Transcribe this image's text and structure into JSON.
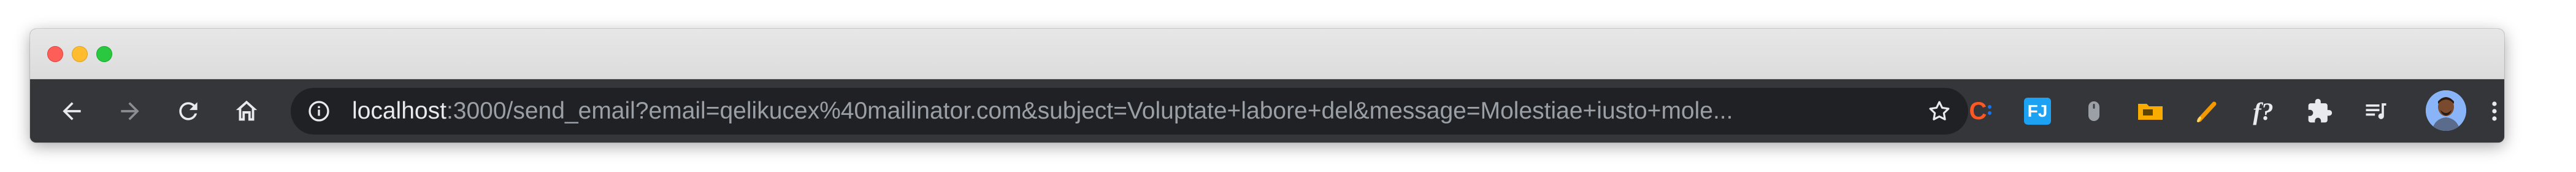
{
  "window": {
    "traffic_lights": {
      "close": "#fd5e57",
      "minimize": "#febc2e",
      "maximize": "#29c840"
    }
  },
  "toolbar": {
    "back_icon": "arrow-left-icon",
    "forward_icon": "arrow-right-icon",
    "reload_icon": "reload-icon",
    "home_icon": "home-icon"
  },
  "omnibox": {
    "info_icon": "info-icon",
    "url_host": "localhost",
    "url_rest": ":3000/send_email?email=qelikucex%40mailinator.com&subject=Voluptate+labore+del&message=Molestiae+iusto+mole...",
    "bookmark_icon": "star-icon"
  },
  "extensions": [
    {
      "name": "c-extension-icon",
      "label": "C",
      "color": "#ff5722"
    },
    {
      "name": "fj-extension-icon",
      "label": "FJ",
      "color": "#1da1f2"
    },
    {
      "name": "mouse-extension-icon"
    },
    {
      "name": "folder-extension-icon",
      "color": "#f9ab00"
    },
    {
      "name": "pen-extension-icon",
      "color": "#f29900"
    },
    {
      "name": "fonts-extension-icon",
      "label": "f?"
    },
    {
      "name": "puzzle-extensions-icon"
    },
    {
      "name": "media-queue-icon"
    }
  ],
  "profile": {
    "avatar_icon": "profile-avatar-icon"
  },
  "menu": {
    "icon": "kebab-menu-icon"
  }
}
